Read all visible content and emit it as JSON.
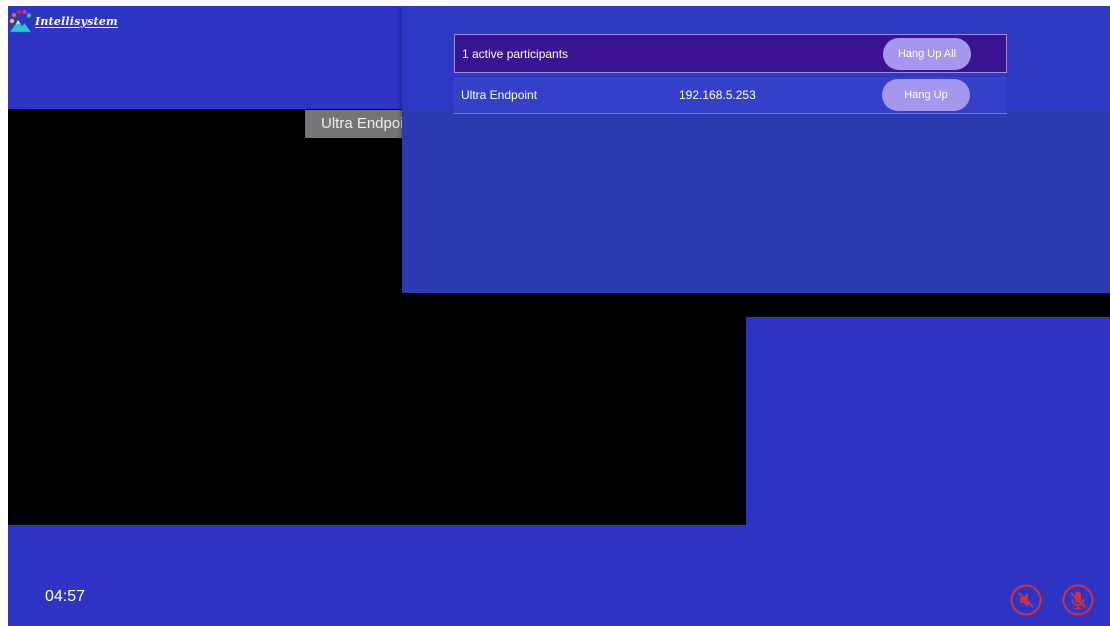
{
  "brand": {
    "logo_text": "Intellisystem"
  },
  "video": {
    "overlay_name": "Ultra Endpoint"
  },
  "participants_panel": {
    "summary": "1 active participants",
    "hang_up_all_label": "Hang Up All",
    "participants": [
      {
        "name": "Ultra Endpoint",
        "ip": "192.168.5.253",
        "hang_up_label": "Hang Up"
      }
    ]
  },
  "call": {
    "timer": "04:57"
  },
  "controls": {
    "speaker_icon": "speaker-muted-icon",
    "mic_icon": "mic-muted-icon",
    "muted_color": "#d3303e"
  },
  "colors": {
    "background": "#2e34c4",
    "panel": "#2d3ab0",
    "selected_row": "#3a1490",
    "button": "#a596ee"
  }
}
